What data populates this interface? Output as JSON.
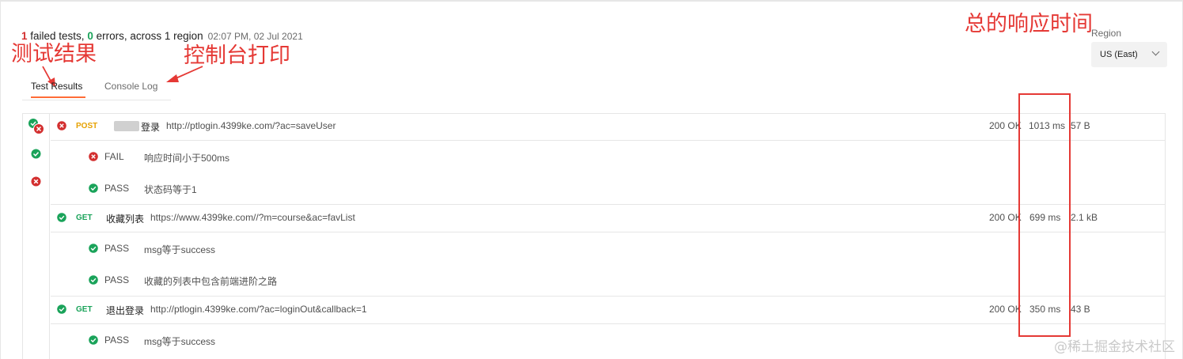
{
  "summary": {
    "failed_count": "1",
    "failed_text": " failed tests, ",
    "errors_count": "0",
    "errors_text": " errors, across ",
    "regions_count": "1",
    "regions_text": " region",
    "timestamp": "02:07 PM, 02 Jul 2021"
  },
  "annotations": {
    "test_results": "测试结果",
    "console_log": "控制台打印",
    "total_response_time": "总的响应时间"
  },
  "tabs": [
    {
      "label": "Test Results",
      "active": true
    },
    {
      "label": "Console Log",
      "active": false
    }
  ],
  "region": {
    "label": "Region",
    "value": "US (East)"
  },
  "requests": [
    {
      "method": "POST",
      "name": "登录",
      "url": "http://ptlogin.4399ke.com/?ac=saveUser",
      "status": "200 OK",
      "time": "1013 ms",
      "size": "57 B",
      "passed": false,
      "tests": [
        {
          "result": "FAIL",
          "name": "响应时间小于500ms"
        },
        {
          "result": "PASS",
          "name": "状态码等于1"
        }
      ]
    },
    {
      "method": "GET",
      "name": "收藏列表",
      "url": "https://www.4399ke.com//?m=course&ac=favList",
      "status": "200 OK",
      "time": "699 ms",
      "size": "2.1 kB",
      "passed": true,
      "tests": [
        {
          "result": "PASS",
          "name": "msg等于success"
        },
        {
          "result": "PASS",
          "name": "收藏的列表中包含前端进阶之路"
        }
      ]
    },
    {
      "method": "GET",
      "name": "退出登录",
      "url": "http://ptlogin.4399ke.com/?ac=loginOut&callback=1",
      "status": "200 OK",
      "time": "350 ms",
      "size": "43 B",
      "passed": true,
      "tests": [
        {
          "result": "PASS",
          "name": "msg等于success"
        }
      ]
    }
  ],
  "watermark": "@稀土掘金技术社区",
  "colors": {
    "pass": "#1aa35a",
    "fail": "#d32f2f",
    "annotation": "#e53935",
    "accent": "#ff6c37"
  }
}
